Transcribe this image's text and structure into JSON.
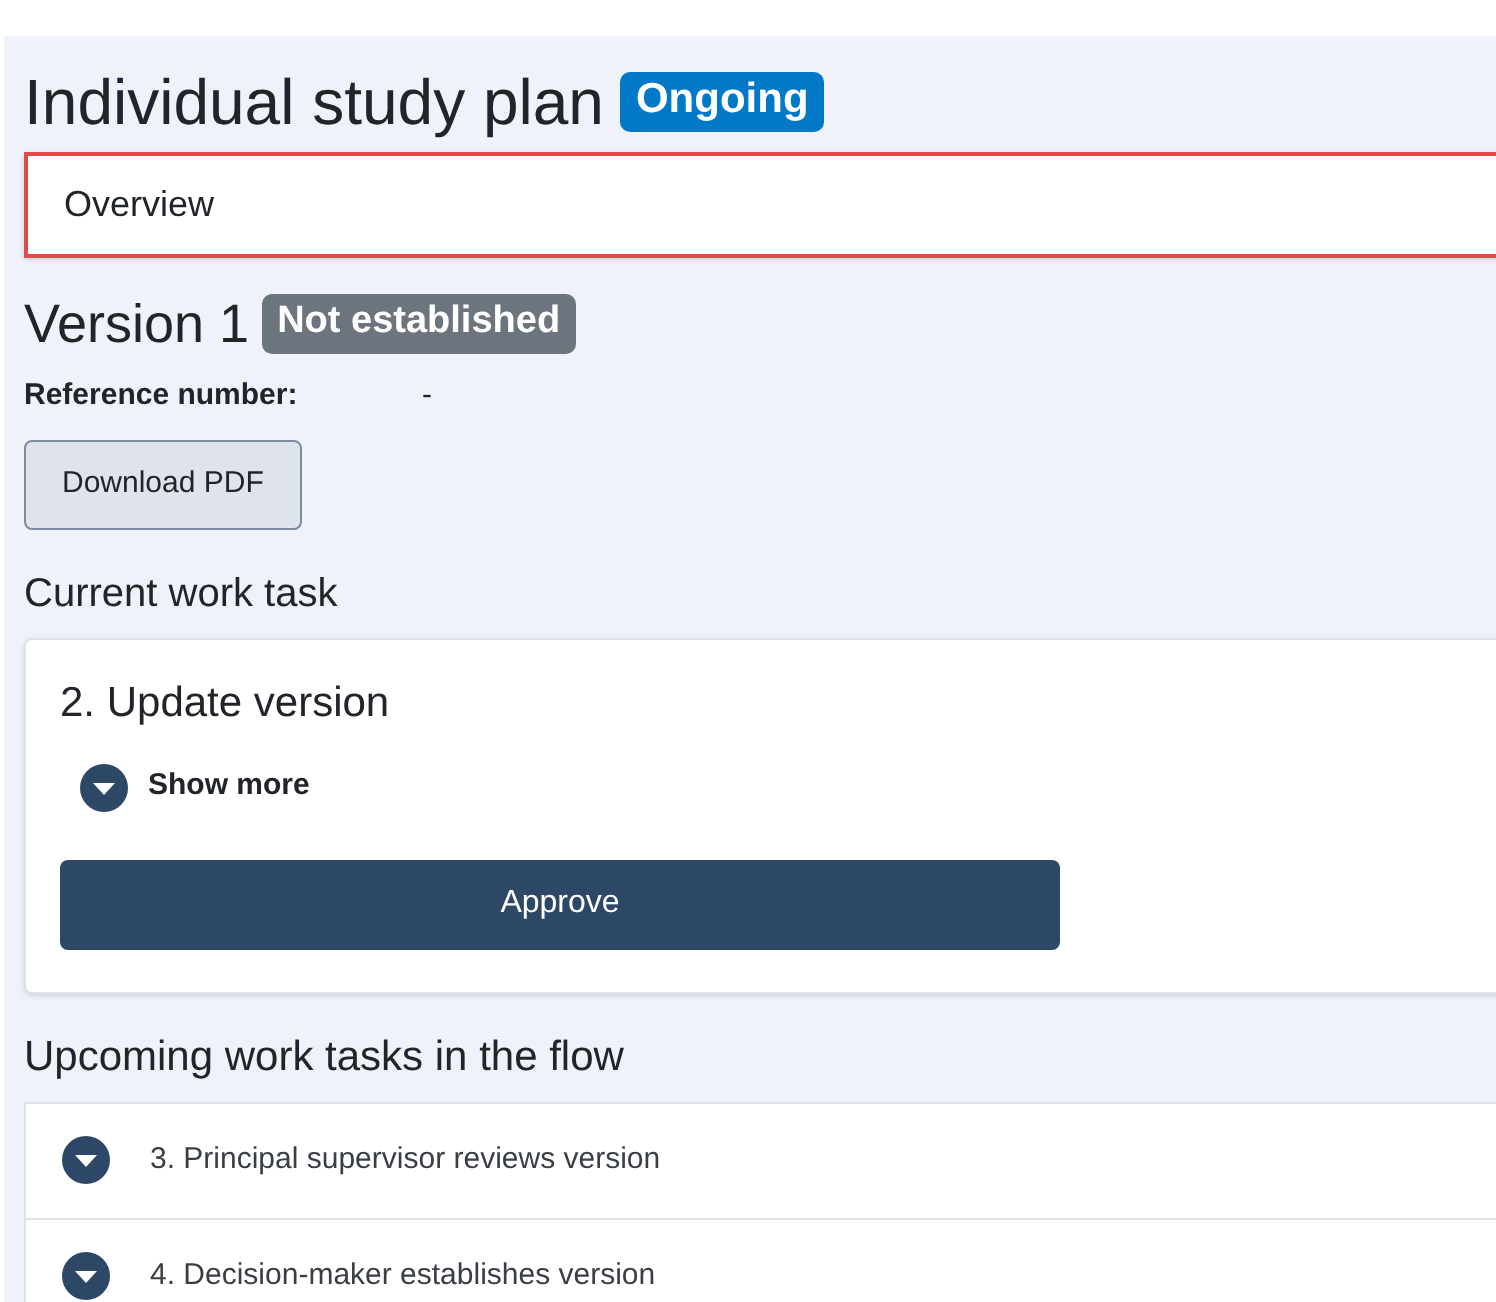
{
  "page": {
    "title": "Individual study plan",
    "status": "Ongoing"
  },
  "view_select": {
    "value": "Overview"
  },
  "version": {
    "title": "Version 1",
    "status": "Not established"
  },
  "reference": {
    "label": "Reference number:",
    "value": "-"
  },
  "download_button": "Download PDF",
  "current_task": {
    "heading": "Current work task",
    "title": "2. Update version",
    "toggle": {
      "label": "Show more",
      "expanded": false
    },
    "button": "Approve"
  },
  "upcoming": {
    "heading": "Upcoming work tasks in the flow",
    "items": [
      {
        "label": "3. Principal supervisor reviews version",
        "expanded": false
      },
      {
        "label": "4. Decision-maker establishes version",
        "expanded": false
      }
    ]
  }
}
